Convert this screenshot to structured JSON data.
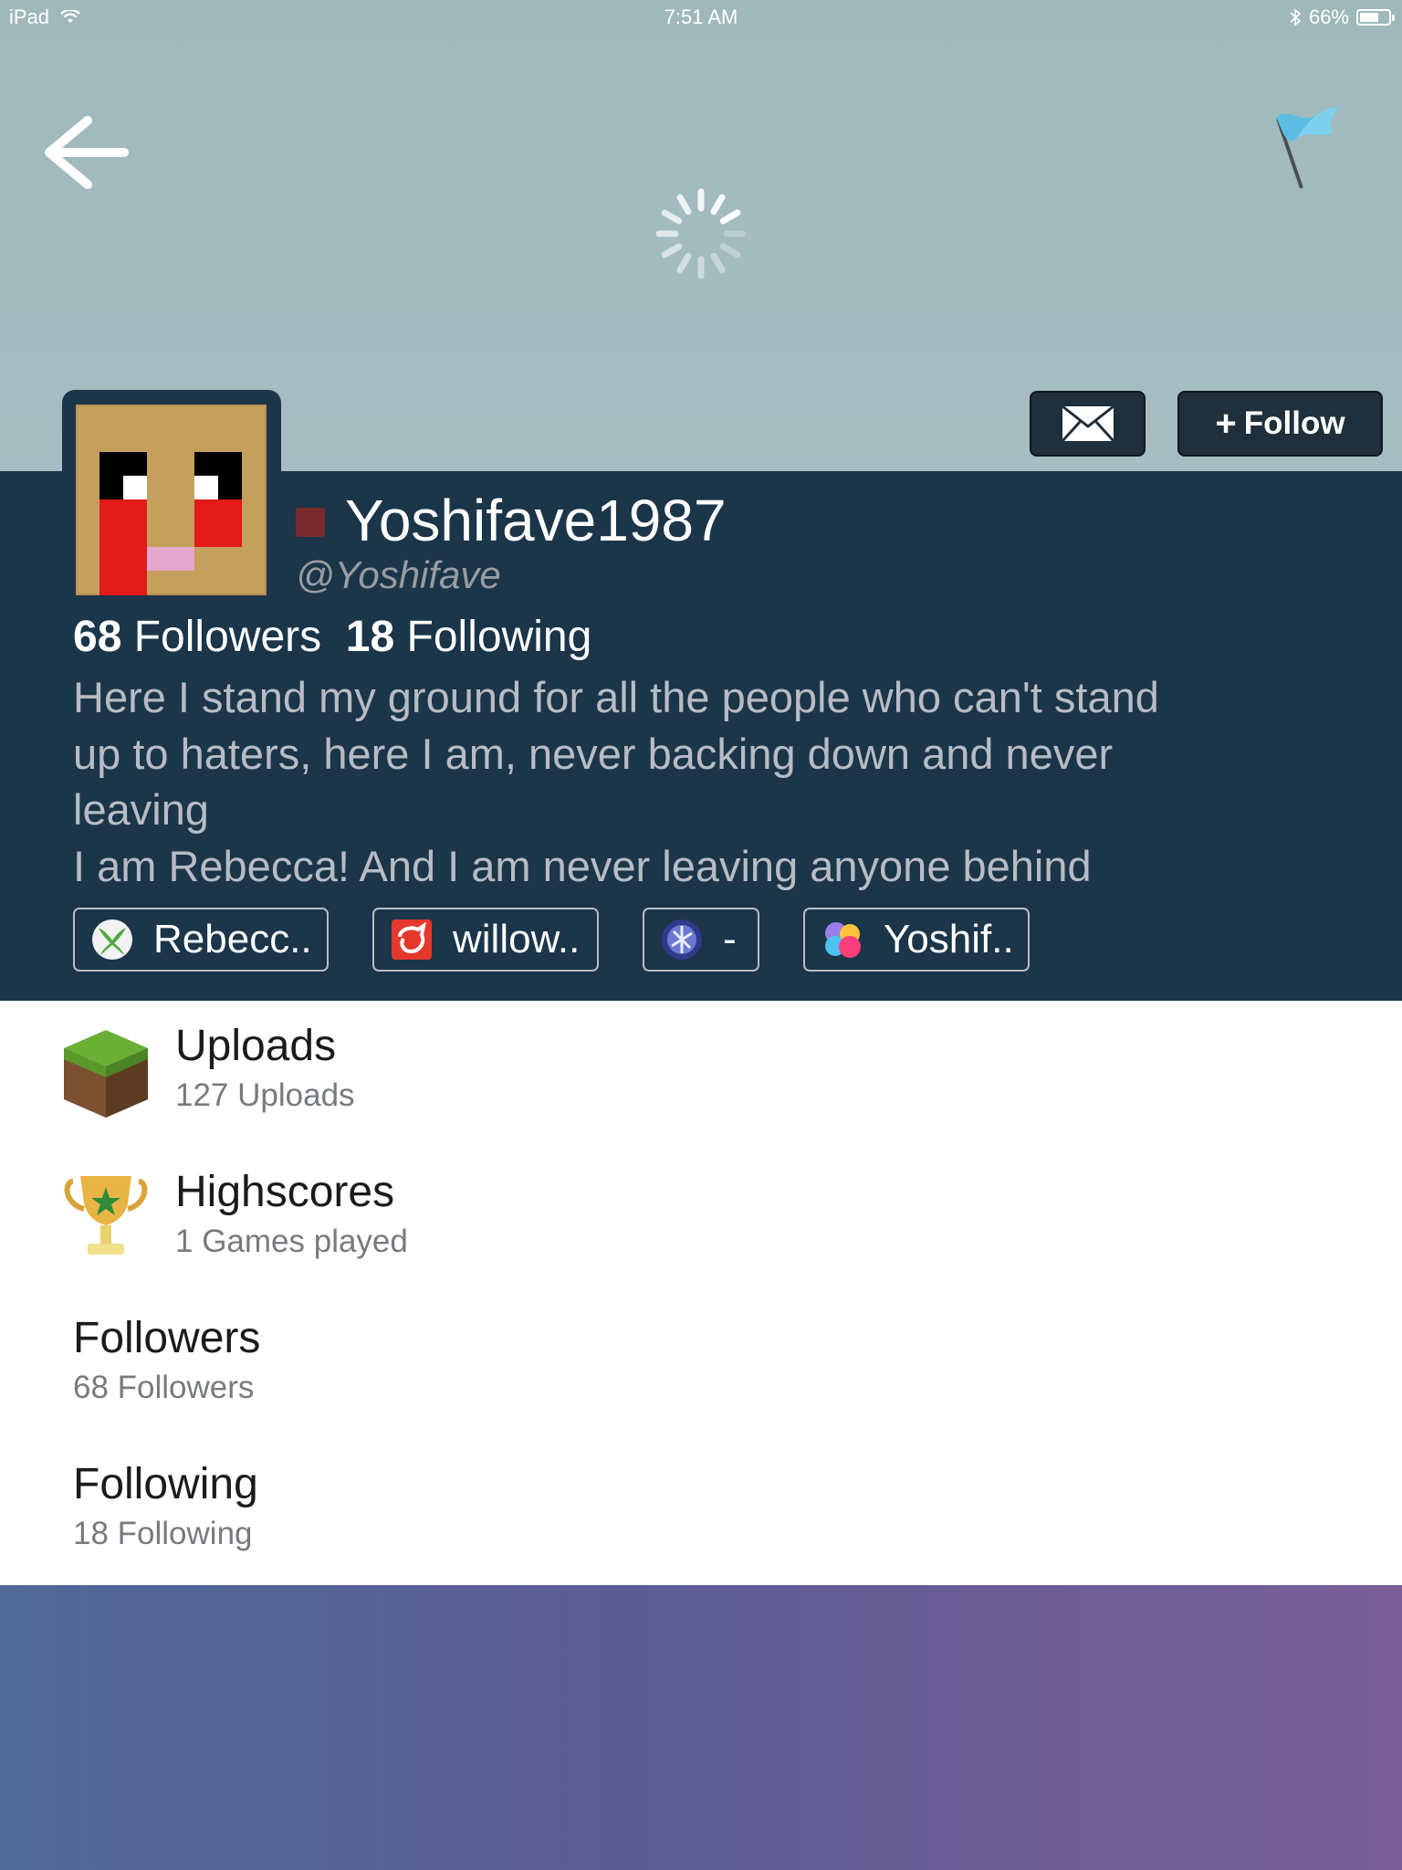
{
  "status_bar": {
    "device": "iPad",
    "time": "7:51 AM",
    "battery": "66%",
    "battery_fraction": 0.66
  },
  "header": {
    "message_icon": "envelope-icon",
    "follow_label": "Follow",
    "follow_prefix": "+"
  },
  "profile": {
    "display_name": "Yoshifave1987",
    "username": "@Yoshifave",
    "status_color": "#7a2a2c",
    "followers_count": "68",
    "followers_label": "Followers",
    "following_count": "18",
    "following_label": "Following",
    "bio_lines": [
      "Here I stand my ground for all the people who can't stand",
      "up to haters, here I am, never backing down and never",
      "leaving",
      "I am Rebecca! And I am never leaving anyone behind"
    ]
  },
  "accounts": [
    {
      "service_icon": "xbox-icon",
      "label": "Rebecc.."
    },
    {
      "service_icon": "willow-icon",
      "label": "willow.."
    },
    {
      "service_icon": "playstation-icon",
      "label": "-"
    },
    {
      "service_icon": "game-center-icon",
      "label": "Yoshif.."
    }
  ],
  "list": {
    "uploads": {
      "title": "Uploads",
      "subtitle": "127 Uploads",
      "icon": "grass-block-icon"
    },
    "highscores": {
      "title": "Highscores",
      "subtitle": "1 Games played",
      "icon": "trophy-icon"
    },
    "followers": {
      "title": "Followers",
      "subtitle": "68 Followers"
    },
    "following": {
      "title": "Following",
      "subtitle": "18 Following"
    }
  },
  "colors": {
    "profile_band": "#1b3549",
    "button_bg": "#1f2f3b"
  }
}
